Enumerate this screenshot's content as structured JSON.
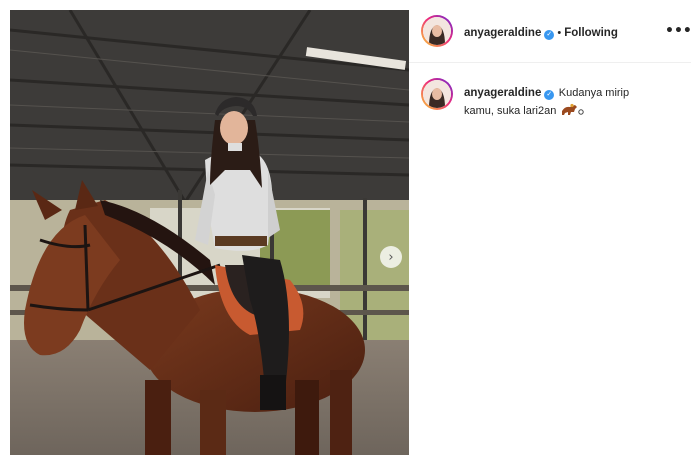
{
  "post": {
    "author": {
      "username": "anyageraldine",
      "verified_icon": "verified-badge-icon",
      "verified_mark": "✓",
      "separator": "•",
      "follow_status": "Following"
    },
    "more_options_label": "•••",
    "next_arrow": "›",
    "caption": {
      "username": "anyageraldine",
      "line1": "Kudanya mirip",
      "line2": "kamu, suka lari2an",
      "emoji_icon": "horse-racing-icon"
    },
    "colors": {
      "verified": "#3897f0",
      "story_ring_start": "#f9ce34",
      "story_ring_mid": "#ee2a7b",
      "story_ring_end": "#6228d7",
      "divider": "#efefef"
    }
  }
}
